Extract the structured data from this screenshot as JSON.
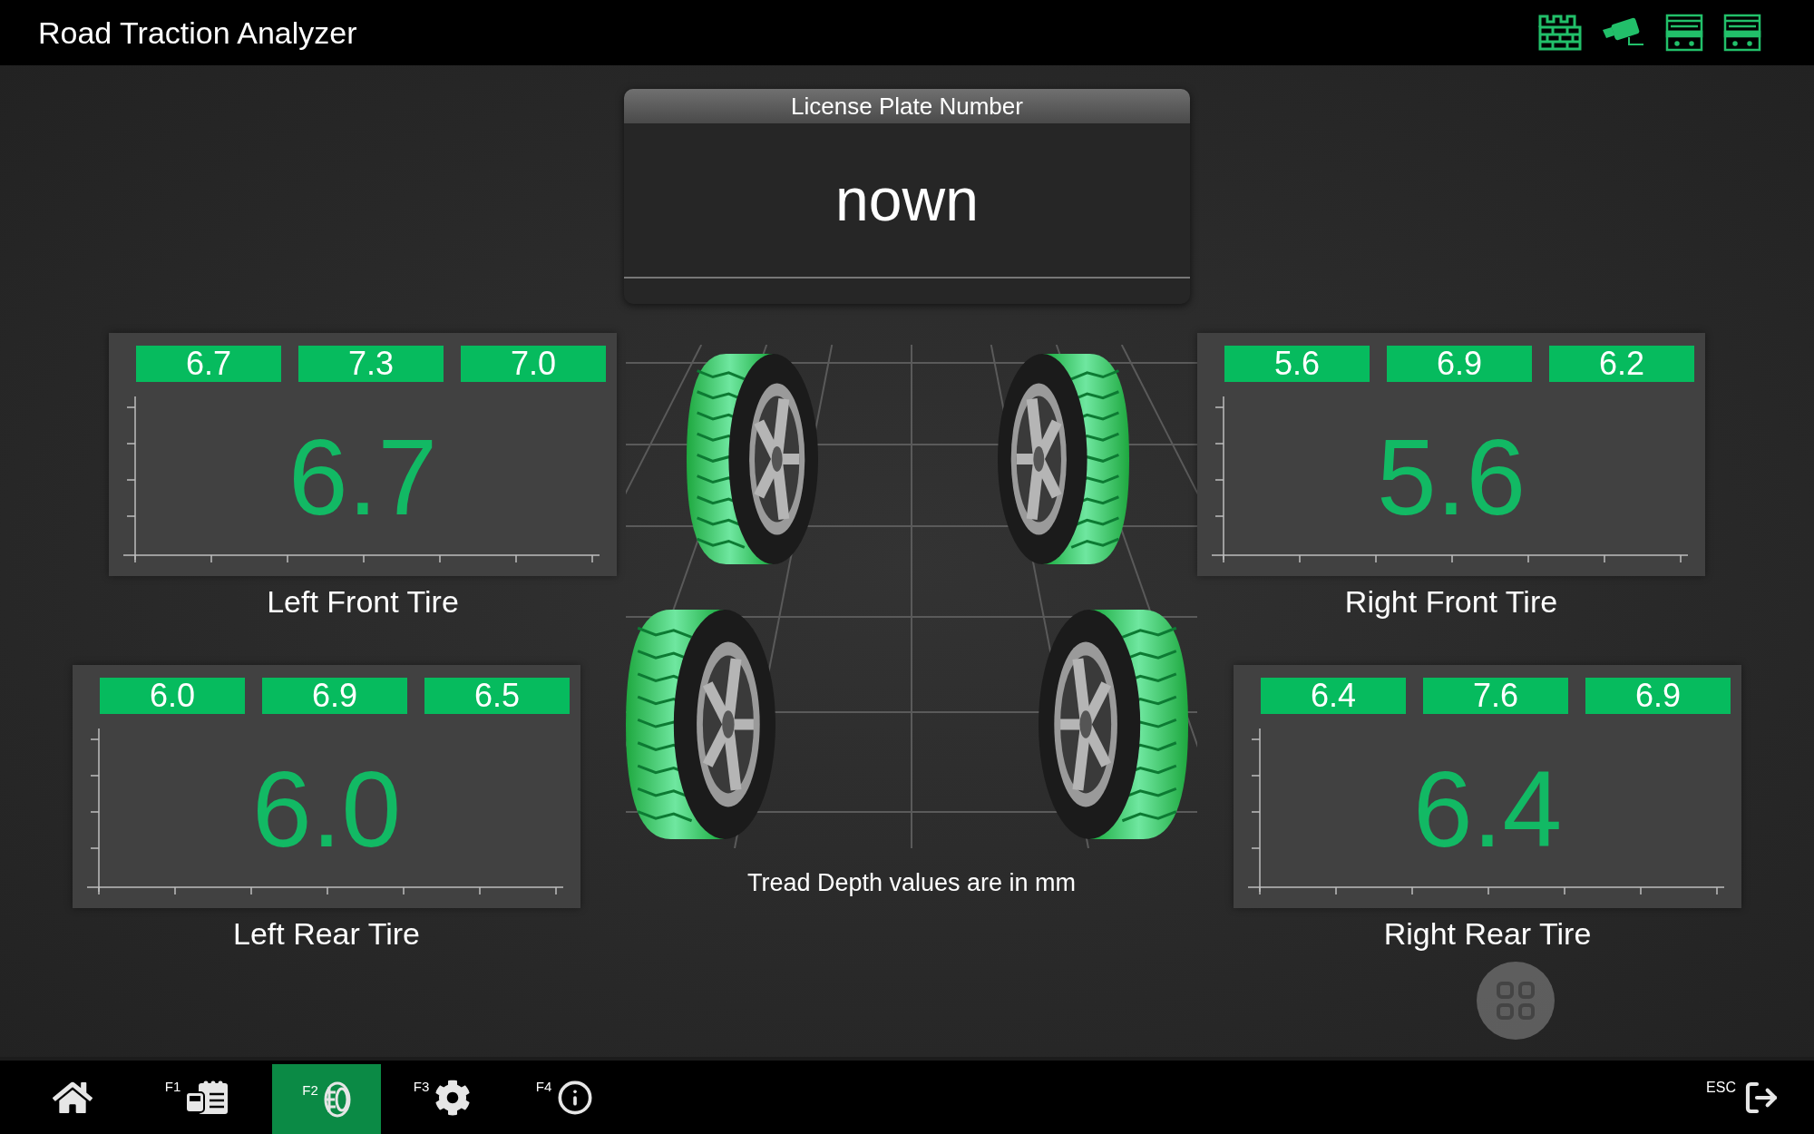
{
  "app": {
    "title": "Road Traction Analyzer"
  },
  "license_plate": {
    "label": "License Plate Number",
    "value": "nown"
  },
  "tires": [
    {
      "name": "Left Front Tire",
      "readings": [
        "6.7",
        "7.3",
        "7.0"
      ],
      "depth": "6.7"
    },
    {
      "name": "Right Front Tire",
      "readings": [
        "5.6",
        "6.9",
        "6.2"
      ],
      "depth": "5.6"
    },
    {
      "name": "Left Rear Tire",
      "readings": [
        "6.0",
        "6.9",
        "6.5"
      ],
      "depth": "6.0"
    },
    {
      "name": "Right Rear Tire",
      "readings": [
        "6.4",
        "7.6",
        "6.9"
      ],
      "depth": "6.4"
    }
  ],
  "note": "Tread Depth values are in mm",
  "function_bar": [
    {
      "kind": "home",
      "selected": false
    },
    {
      "key": "F1",
      "kind": "vehicle",
      "selected": false
    },
    {
      "key": "F2",
      "kind": "tires",
      "selected": true
    },
    {
      "key": "F3",
      "kind": "settings",
      "selected": false
    },
    {
      "key": "F4",
      "kind": "info",
      "selected": false
    }
  ],
  "exit": {
    "key": "ESC"
  }
}
